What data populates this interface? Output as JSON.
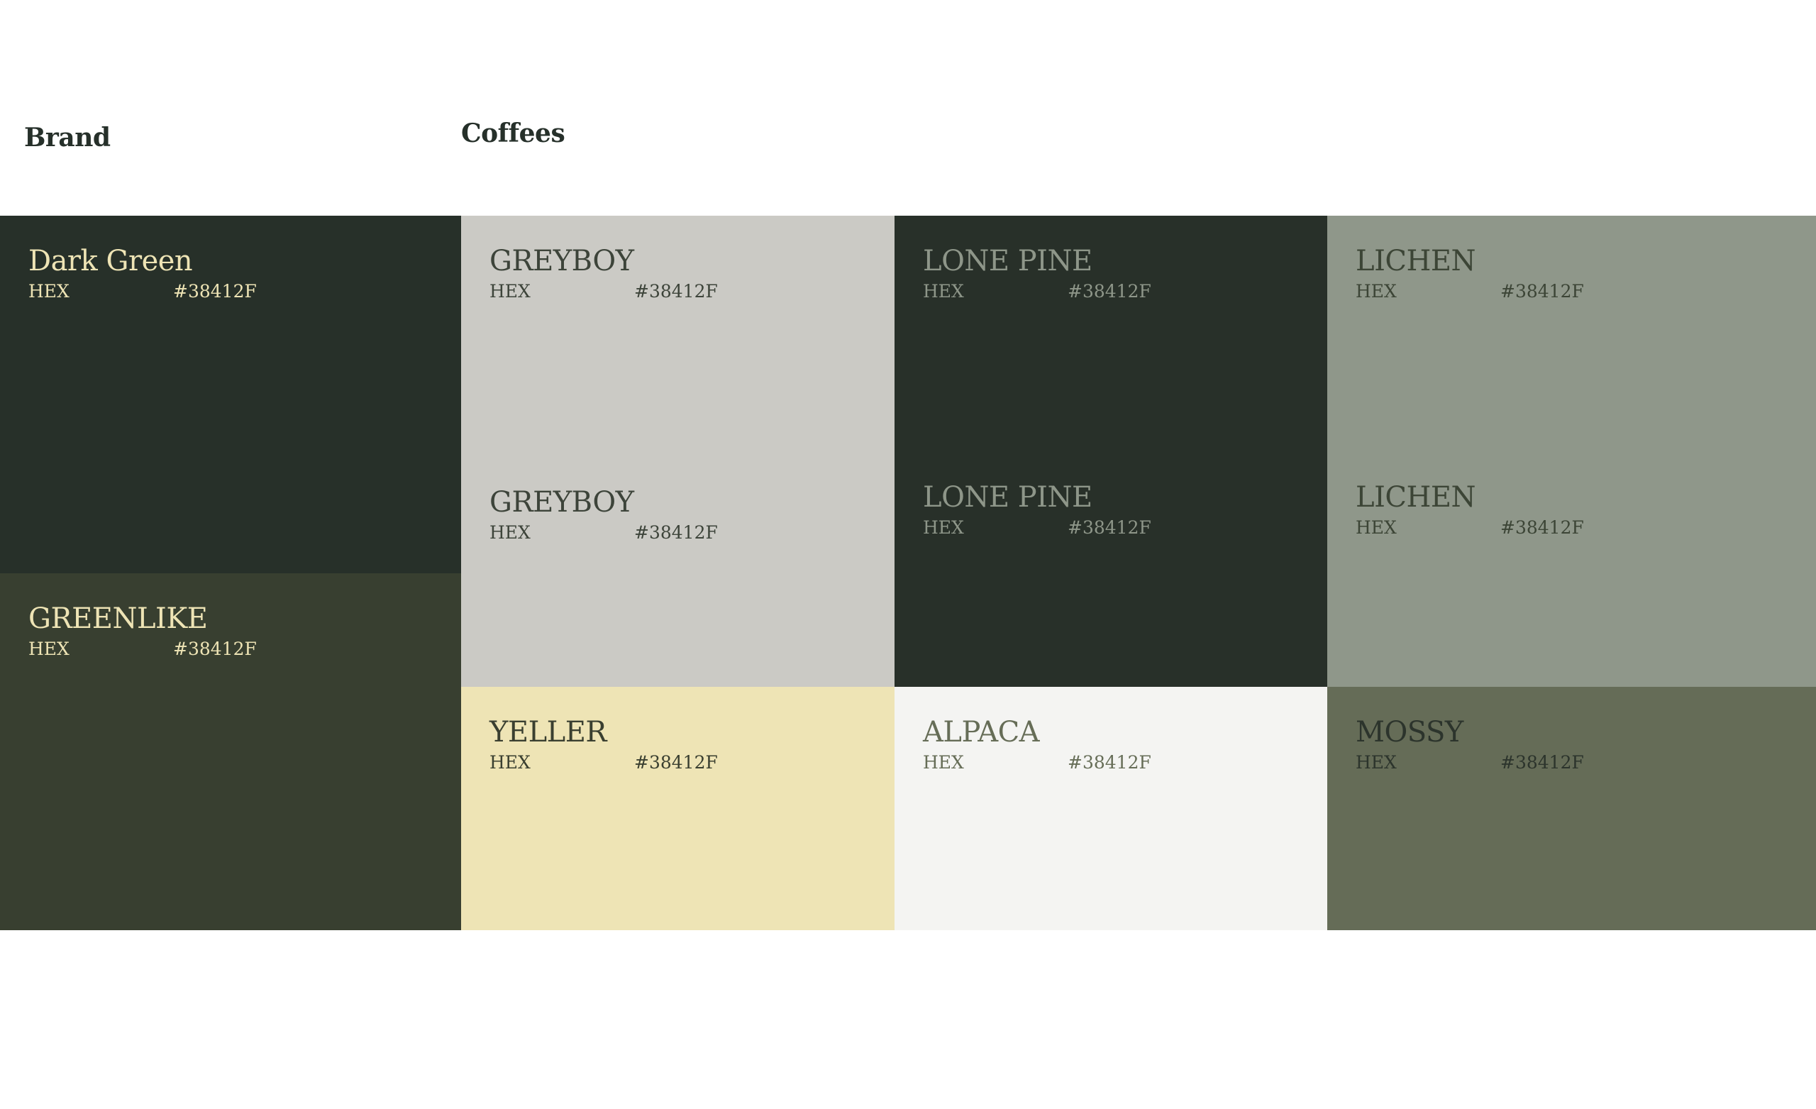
{
  "headings": {
    "brand": "Brand",
    "coffees": "Coffees"
  },
  "brand": {
    "dark_green": {
      "name": "Dark Green",
      "hex_label": "HEX",
      "hex_value": "#38412F",
      "background": "#273029",
      "text_color": "#eee4b5"
    },
    "greenlike": {
      "name": "GREENLIKE",
      "hex_label": "HEX",
      "hex_value": "#38412F",
      "background": "#383f30",
      "text_color": "#eee4b5"
    }
  },
  "coffees": {
    "greyboy": {
      "name": "GREYBOY",
      "name_repeat": "GREYBOY",
      "hex_label": "HEX",
      "hex_value": "#38412F",
      "hex_label_repeat": "HEX",
      "hex_value_repeat": "#38412F",
      "background": "#cbcac5",
      "text_color": "#3d443a"
    },
    "lone_pine": {
      "name": "LONE PINE",
      "name_repeat": "LONE PINE",
      "hex_label": "HEX",
      "hex_value": "#38412F",
      "hex_label_repeat": "HEX",
      "hex_value_repeat": "#38412F",
      "background": "#283029",
      "text_color": "#8e9689"
    },
    "lichen": {
      "name": "LICHEN",
      "name_repeat": "LICHEN",
      "hex_label": "HEX",
      "hex_value": "#38412F",
      "hex_label_repeat": "HEX",
      "hex_value_repeat": "#38412F",
      "background": "#8f978a",
      "text_color": "#3c4536"
    },
    "yeller": {
      "name": "YELLER",
      "hex_label": "HEX",
      "hex_value": "#38412F",
      "background": "#eee4b5",
      "text_color": "#3a3f30"
    },
    "alpaca": {
      "name": "ALPACA",
      "hex_label": "HEX",
      "hex_value": "#38412F",
      "background": "#f4f4f2",
      "text_color": "#666d57"
    },
    "mossy": {
      "name": "MOSSY",
      "hex_label": "HEX",
      "hex_value": "#38412F",
      "background": "#656c57",
      "text_color": "#2c342c"
    }
  }
}
